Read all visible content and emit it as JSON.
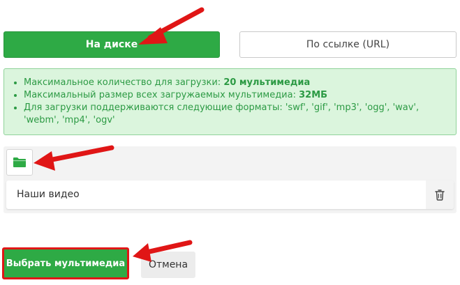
{
  "tabs": {
    "disk": "На диске",
    "url": "По ссылке (URL)"
  },
  "info": {
    "max_count_label": "Максимальное количество для загрузки:",
    "max_count_value": "20 мультимедиа",
    "max_size_label": "Максимальный размер всех загружаемых мультимедиа:",
    "max_size_value": "32МБ",
    "formats_label": "Для загрузки поддерживаются следующие форматы: 'swf', 'gif', 'mp3', 'ogg', 'wav', 'webm', 'mp4', 'ogv'"
  },
  "upload": {
    "folder_icon": "folder-icon",
    "file_name": "Наши видео",
    "trash_icon": "trash-icon"
  },
  "footer": {
    "select_label": "Выбрать мультимедиа",
    "cancel_label": "Отмена"
  },
  "colors": {
    "accent_green": "#2eaa45",
    "info_bg": "#dbf5dd",
    "highlight_red": "#e01616"
  }
}
